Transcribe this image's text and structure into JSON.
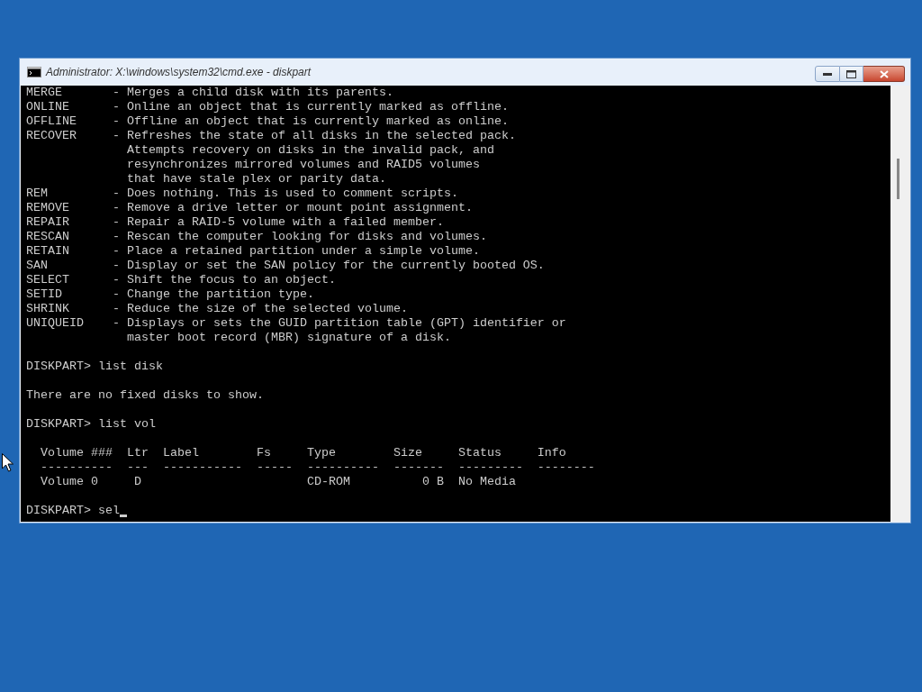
{
  "window": {
    "title": "Administrator: X:\\windows\\system32\\cmd.exe - diskpart"
  },
  "console": {
    "blocks": [
      [
        "MERGE       - Merges a child disk with its parents.",
        "ONLINE      - Online an object that is currently marked as offline.",
        "OFFLINE     - Offline an object that is currently marked as online.",
        "RECOVER     - Refreshes the state of all disks in the selected pack.",
        "              Attempts recovery on disks in the invalid pack, and",
        "              resynchronizes mirrored volumes and RAID5 volumes",
        "              that have stale plex or parity data.",
        "REM         - Does nothing. This is used to comment scripts.",
        "REMOVE      - Remove a drive letter or mount point assignment.",
        "REPAIR      - Repair a RAID-5 volume with a failed member.",
        "RESCAN      - Rescan the computer looking for disks and volumes.",
        "RETAIN      - Place a retained partition under a simple volume.",
        "SAN         - Display or set the SAN policy for the currently booted OS.",
        "SELECT      - Shift the focus to an object.",
        "SETID       - Change the partition type.",
        "SHRINK      - Reduce the size of the selected volume.",
        "UNIQUEID    - Displays or sets the GUID partition table (GPT) identifier or",
        "              master boot record (MBR) signature of a disk."
      ],
      [
        "DISKPART> list disk"
      ],
      [
        "There are no fixed disks to show."
      ],
      [
        "DISKPART> list vol"
      ],
      [
        "  Volume ###  Ltr  Label        Fs     Type        Size     Status     Info",
        "  ----------  ---  -----------  -----  ----------  -------  ---------  --------",
        "  Volume 0     D                       CD-ROM          0 B  No Media"
      ],
      [
        "DISKPART> sel"
      ]
    ]
  }
}
